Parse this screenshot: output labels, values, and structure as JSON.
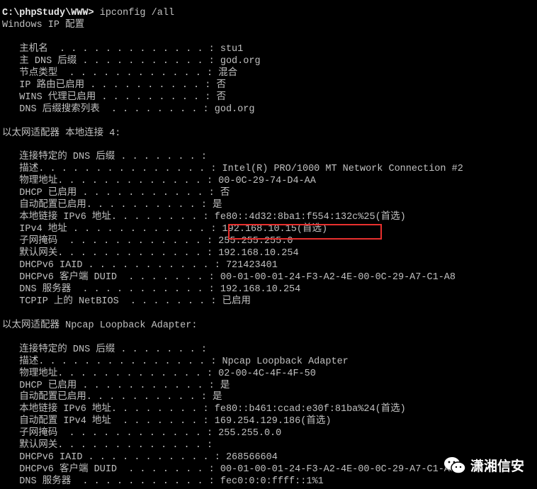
{
  "prompt": {
    "path": "C:\\phpStudy\\WWW>",
    "command": " ipconfig /all"
  },
  "lines": [
    "Windows IP 配置",
    "",
    "   主机名  . . . . . . . . . . . . . : stu1",
    "   主 DNS 后缀 . . . . . . . . . . . : god.org",
    "   节点类型  . . . . . . . . . . . . : 混合",
    "   IP 路由已启用 . . . . . . . . . . : 否",
    "   WINS 代理已启用 . . . . . . . . . : 否",
    "   DNS 后缀搜索列表  . . . . . . . . : god.org",
    "",
    "以太网适配器 本地连接 4:",
    "",
    "   连接特定的 DNS 后缀 . . . . . . . :",
    "   描述. . . . . . . . . . . . . . . : Intel(R) PRO/1000 MT Network Connection #2",
    "   物理地址. . . . . . . . . . . . . : 00-0C-29-74-D4-AA",
    "   DHCP 已启用 . . . . . . . . . . . : 否",
    "   自动配置已启用. . . . . . . . . . : 是",
    "   本地链接 IPv6 地址. . . . . . . . : fe80::4d32:8ba1:f554:132c%25(首选)",
    "   IPv4 地址 . . . . . . . . . . . . : 192.168.10.15(首选)",
    "   子网掩码  . . . . . . . . . . . . : 255.255.255.0",
    "   默认网关. . . . . . . . . . . . . : 192.168.10.254",
    "   DHCPv6 IAID . . . . . . . . . . . : 721423401",
    "   DHCPv6 客户端 DUID  . . . . . . . : 00-01-00-01-24-F3-A2-4E-00-0C-29-A7-C1-A8",
    "   DNS 服务器  . . . . . . . . . . . : 192.168.10.254",
    "   TCPIP 上的 NetBIOS  . . . . . . . : 已启用",
    "",
    "以太网适配器 Npcap Loopback Adapter:",
    "",
    "   连接特定的 DNS 后缀 . . . . . . . :",
    "   描述. . . . . . . . . . . . . . . : Npcap Loopback Adapter",
    "   物理地址. . . . . . . . . . . . . : 02-00-4C-4F-4F-50",
    "   DHCP 已启用 . . . . . . . . . . . : 是",
    "   自动配置已启用. . . . . . . . . . : 是",
    "   本地链接 IPv6 地址. . . . . . . . : fe80::b461:ccad:e30f:81ba%24(首选)",
    "   自动配置 IPv4 地址  . . . . . . . : 169.254.129.186(首选)",
    "   子网掩码  . . . . . . . . . . . . : 255.255.0.0",
    "   默认网关. . . . . . . . . . . . . :",
    "   DHCPv6 IAID . . . . . . . . . . . : 268566604",
    "   DHCPv6 客户端 DUID  . . . . . . . : 00-01-00-01-24-F3-A2-4E-00-0C-29-A7-C1-A8",
    "   DNS 服务器  . . . . . . . . . . . : fec0:0:0:ffff::1%1"
  ],
  "highlight_color": "#e8302e",
  "watermark": {
    "icon": "wechat-icon",
    "text": "潇湘信安"
  }
}
